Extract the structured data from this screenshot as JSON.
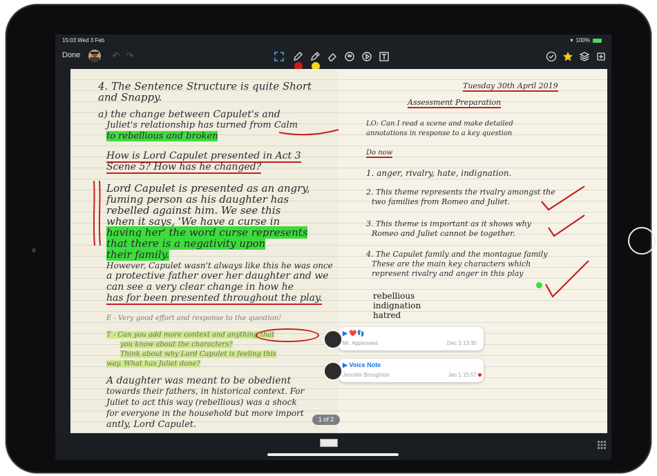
{
  "status_bar": {
    "time": "15:03  Wed 3 Feb",
    "battery": "100%"
  },
  "toolbar": {
    "done_label": "Done",
    "tools": [
      "fullscreen-icon",
      "pen-icon",
      "highlighter-icon",
      "eraser-icon",
      "comment-icon",
      "audio-icon",
      "text-icon"
    ],
    "right_tools": [
      "check-circle-icon",
      "star-icon",
      "layers-icon",
      "export-icon"
    ]
  },
  "left_page": {
    "lines": [
      "4. The  Sentence  Structure  is  quite  Short",
      "and  Snappy.",
      "a) the  change  between  Capulet's  and",
      "Juliet's  relationship  has  turned  from  Calm",
      "to  rebellious  and  broken",
      "How  is  Lord  Capulet  presented  in  Act 3",
      "Scene 5? How has he changed?",
      "Lord  Capulet  is  presented  as  an angry,",
      "fuming  person  as  his  daughter  has",
      "rebelled  against  him. We  see  this",
      "when  it  says,  'We  have  a  curse  in",
      "having  her'  the  word  curse  represents",
      "that  there  is  a  negativity  upon",
      "their  family.",
      "However,  Capulet  wasn't  always  like this  he was once",
      "a protective  father  over  her  daughter  and we",
      "can  see  a  very  clear  change  in  how  he",
      "has  for  been  presented  throughout  the  play.",
      "E - Very good effort and response to the question!",
      "T - Can you add more context and anything that",
      "you know about the characters?",
      "Think about why Lord Capulet is feeling this",
      "way. What has Juliet done?",
      "A  daughter  was  meant  to  be  obedient",
      "towards  their  fathers,  in  historical  context.  For",
      "Juliet  to  act  this  way  (rebellious)  was  a  shock",
      "for  everyone  in  the  household  but  more  import",
      "antly,  Lord  Capulet."
    ]
  },
  "right_page": {
    "date": "Tuesday 30th April 2019",
    "heading": "Assessment Preparation",
    "lines": [
      "LO: Can I read a scene and make detailed",
      "annotations in response to a key question",
      "Do now",
      "1. anger,  rivalry,  hate,  indignation.",
      "2. This  theme  represents  the  rivalry  amongst  the",
      "two  families  from  Romeo and  Juliet.",
      "3. This  theme  is  important  as it  shows  why",
      "Romeo  and Juliet  cannot  be  together.",
      "4. The  Capulet  family and  the  montague  family",
      "These  are  the  main  key  characters  which",
      "represent  rivalry and  anger  in  this  play",
      "rebellious",
      "indignation",
      "hatred"
    ]
  },
  "comments": [
    {
      "title": "▶ ❤️👣",
      "author": "Mr. Appleseed",
      "date": "Dec 3 13:30"
    },
    {
      "title": "▶ Voice Note",
      "author": "Jennifer Broughton",
      "date": "Jan 1 15:57"
    }
  ],
  "page_indicator": "1 of 2",
  "colors": {
    "highlight_green": "#3ddc3d",
    "highlight_light": "#cfe98b",
    "ink_red": "#c41e1e",
    "accent_blue": "#1a73e8"
  }
}
